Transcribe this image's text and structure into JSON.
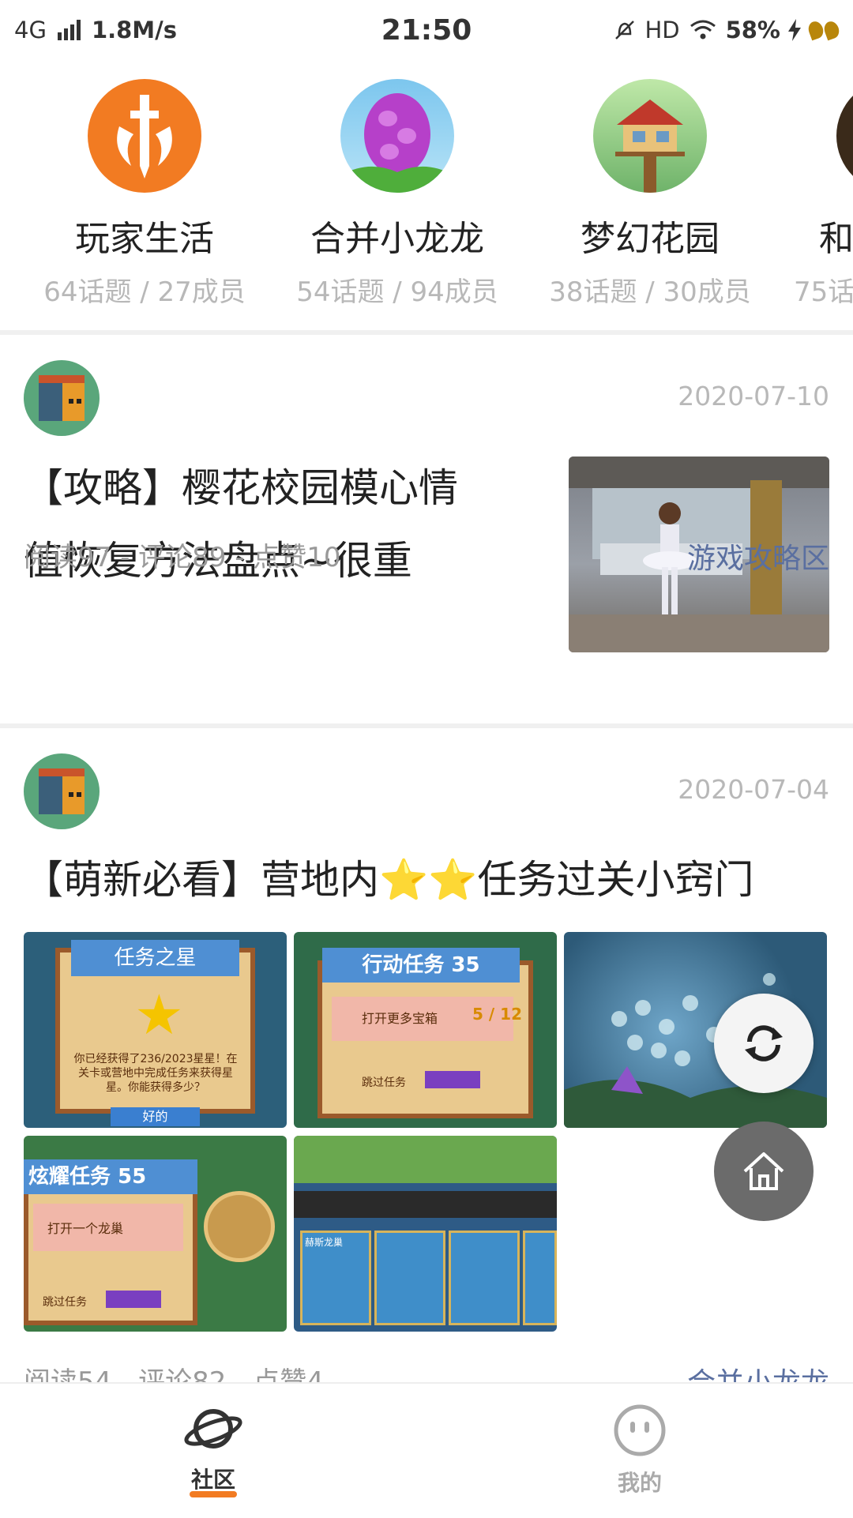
{
  "status_bar": {
    "network": "4G",
    "speed": "1.8M/s",
    "time": "21:50",
    "hd": "HD",
    "battery": "58%"
  },
  "circles": [
    {
      "name": "玩家生活",
      "meta": "64话题 / 27成员"
    },
    {
      "name": "合并小龙龙",
      "meta": "54话题 / 94成员"
    },
    {
      "name": "梦幻花园",
      "meta": "38话题 / 30成员"
    },
    {
      "name": "和",
      "meta": "75话"
    }
  ],
  "posts": [
    {
      "date": "2020-07-10",
      "title_lines": [
        "【攻略】樱花校园模心情",
        "值恢复方法盘点~很重"
      ],
      "stats": "阅读97 - 评论89 - 点赞10",
      "tag": "游戏攻略区"
    },
    {
      "date": "2020-07-04",
      "title": "【萌新必看】营地内⭐⭐任务过关小窍门",
      "stats": "阅读54 - 评论82 - 点赞4",
      "tag": "合并小龙龙",
      "image_texts": {
        "img1_title": "任务之星",
        "img1_body": "你已经获得了236/2023星星！在关卡或营地中完成任务来获得星星。你能获得多少？",
        "img1_button": "好的",
        "img2_title": "行动任务 35",
        "img2_task": "打开更多宝箱",
        "img2_progress": "5 / 12",
        "img2_button": "跳过任务",
        "img4_title": "炫耀任务 55",
        "img4_task": "打开一个龙巢",
        "img4_button": "跳过任务",
        "img5_label": "赫斯龙巢"
      }
    }
  ],
  "nav": {
    "community": "社区",
    "mine": "我的"
  },
  "colors": {
    "accent": "#f27b22",
    "tag_blue": "#5a6fa0",
    "meta_gray": "#b8b8b8"
  }
}
